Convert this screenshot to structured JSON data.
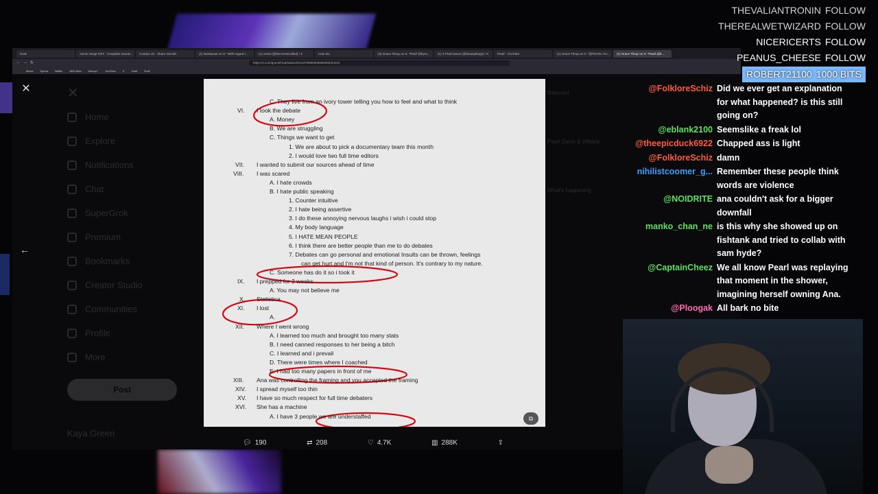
{
  "browser": {
    "tabs": [
      "Grok",
      "Axiom Verge OST - Complete Sound...",
      "Contact Us - Share Out DE",
      "(1) liveDacast on X: \"With regard t...",
      "(1) Annie (@theAnnieCalled) / X",
      "How Sis",
      "(3) Grace Thrup on X: \"Pearl @bycx...",
      "(1) X Pearl Davis (@beautyfangs) / X",
      "Pearl - YouTube",
      "(1) Grace Thrup on X: \"@PEARL Prc...",
      "(1) Grace Thrup on X: \"Pearl @b..."
    ],
    "url": "https://x.com/gracethrup/status/2011370688353589290/photo/2",
    "bookmarks": [
      "Mixes",
      "Spend",
      "Netflix",
      "HBO Max",
      "Disney+",
      "YouTube",
      "X",
      "Grail",
      "Grok"
    ]
  },
  "x_page": {
    "nav": [
      "Home",
      "Explore",
      "Notifications",
      "Chat",
      "SuperGrok",
      "Premium",
      "Bookmarks",
      "Creator Studio",
      "Communities",
      "Profile",
      "More"
    ],
    "post_button": "Post",
    "user": "Kaya Green",
    "right_texts": [
      "Relevant",
      "Pearl Davis & Villains",
      "What's happening"
    ]
  },
  "lightbox": {
    "close_icon": "✕",
    "prev_icon": "←",
    "actions": {
      "replies": "190",
      "reposts": "208",
      "likes": "4.7K",
      "views": "288K"
    }
  },
  "document": {
    "lines": [
      {
        "num": "",
        "text": "C.   They live from an ivory tower telling you how to feel and what to think"
      },
      {
        "num": "VI.",
        "text": "I took the debate"
      },
      {
        "num": "",
        "text": "A.   Money"
      },
      {
        "num": "",
        "text": "B.   We are struggling"
      },
      {
        "num": "",
        "text": "C.   Things we want to get"
      },
      {
        "num": "",
        "text": "1.   We are about to pick a documentary team this month"
      },
      {
        "num": "",
        "text": "2.   I would love two full time editors"
      },
      {
        "num": "VII.",
        "text": "I wanted to submit our sources ahead of time"
      },
      {
        "num": "VIII.",
        "text": "I was scared"
      },
      {
        "num": "",
        "text": "A.   I hate crowds"
      },
      {
        "num": "",
        "text": "B.   I hate public speaking"
      },
      {
        "num": "",
        "text": "1.   Counter intuitive"
      },
      {
        "num": "",
        "text": "2.   I hate being assertive"
      },
      {
        "num": "",
        "text": "3.   I do these annoying nervous laughs i wish i could stop"
      },
      {
        "num": "",
        "text": "4.   My body language"
      },
      {
        "num": "",
        "text": "5.   I HATE MEAN PEOPLE"
      },
      {
        "num": "",
        "text": "6.   I think there are better people than me to do debates"
      },
      {
        "num": "",
        "text": "7.   Debates can go personal and emotional Insults can be thrown, feelings"
      },
      {
        "num": "",
        "text": "can get hurt and I'm not that kind of person. It's contrary to my nature."
      },
      {
        "num": "",
        "text": "C.   Someone has do it so i took it"
      },
      {
        "num": "IX.",
        "text": "I prepped for 2 weeks"
      },
      {
        "num": "",
        "text": "A.   You may not believe me"
      },
      {
        "num": "X.",
        "text": "Statistica"
      },
      {
        "num": "XI.",
        "text": "I lost"
      },
      {
        "num": "",
        "text": "A."
      },
      {
        "num": "XII.",
        "text": "Where I went wrong"
      },
      {
        "num": "",
        "text": "A.   I learned too much and brought too many stats"
      },
      {
        "num": "",
        "text": "B.   I need canned responses to her being a bitch"
      },
      {
        "num": "",
        "text": "C.   I learned and i prevail"
      },
      {
        "num": "",
        "text": "D.   There were times where I coached"
      },
      {
        "num": "",
        "text": "E.   I had too many papers in front of me"
      },
      {
        "num": "XIII.",
        "text": "Ana was controlling the framing and you accepted the framing"
      },
      {
        "num": "XIV.",
        "text": "I spread myself too thin"
      },
      {
        "num": "XV.",
        "text": "I have so much respect for full time debaters"
      },
      {
        "num": "XVI.",
        "text": "She has a machine"
      },
      {
        "num": "",
        "text": "A.   I have 3 people we are understaffed"
      }
    ],
    "colors": {
      "ink": "#1a1a1a",
      "circle": "#d10a14",
      "paper": "#e9e9e9"
    }
  },
  "stream": {
    "follow_alerts": [
      {
        "user": "THEVALIANTRONIN",
        "action": "FOLLOW"
      },
      {
        "user": "THEREALWETWIZARD",
        "action": "FOLLOW"
      },
      {
        "user": "NICERICERTS",
        "action": "FOLLOW"
      },
      {
        "user": "PEANUS_CHEESE",
        "action": "FOLLOW"
      },
      {
        "user": "ROBERT21100",
        "action": "1000 BITS"
      }
    ],
    "chat": [
      {
        "user": "@FolkloreSchiz",
        "color": "#ff5a3c",
        "text": "Did we ever get an explanation for what happened? is this still going on?"
      },
      {
        "user": "@eblank2100",
        "color": "#5de05d",
        "text": "Seemslike a freak lol"
      },
      {
        "user": "@theepicduck6922",
        "color": "#ff5a3c",
        "text": "Chapped ass is light"
      },
      {
        "user": "@FolkloreSchiz",
        "color": "#ff5a3c",
        "text": "damn"
      },
      {
        "user": "nihilistcoomer_g...",
        "color": "#3aa0ff",
        "text": "Remember these people think words are violence"
      },
      {
        "user": "@NOIDRITE",
        "color": "#5de05d",
        "text": "ana couldn't ask for a bigger downfall"
      },
      {
        "user": "manko_chan_ne",
        "color": "#5de05d",
        "text": "is this why she showed up on fishtank and tried to collab with sam hyde?"
      },
      {
        "user": "@CaptainCheez",
        "color": "#5de05d",
        "text": "We all know Pearl was replaying that moment in the shower, imagining herself owning Ana."
      },
      {
        "user": "@Ploogak",
        "color": "#ff6ab0",
        "text": "All bark no bite"
      }
    ]
  }
}
